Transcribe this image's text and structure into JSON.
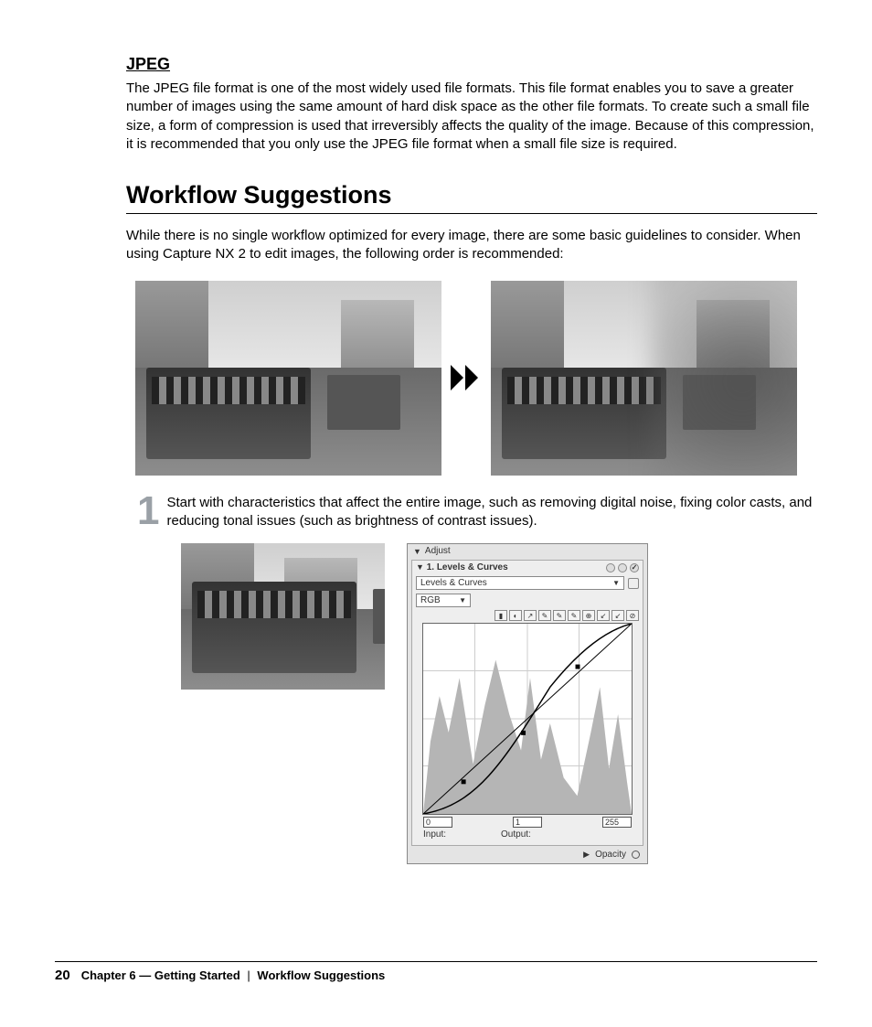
{
  "jpeg": {
    "heading": "JPEG",
    "body": "The JPEG file format is one of the most widely used file formats. This file format enables you to save a greater number of images using the same amount of hard disk space as the other file formats. To create such a small file size, a form of compression is used that irreversibly affects the quality of the image. Because of this compression, it is recommended that you only use the JPEG file format when a small file size is required."
  },
  "workflow": {
    "heading": "Workflow Suggestions",
    "intro": "While there is no single workflow optimized for every image, there are some basic guidelines to consider. When using Capture NX 2 to edit images, the following order is recommended:",
    "step1": {
      "num": "1",
      "text": "Start with characteristics that affect the entire image, such as removing digital noise, fixing color casts, and reducing tonal issues (such as brightness of contrast issues)."
    }
  },
  "panel": {
    "adjust_label": "Adjust",
    "section_title": "1. Levels & Curves",
    "dropdown1": "Levels & Curves",
    "dropdown2": "RGB",
    "input_label": "Input:",
    "output_label": "Output:",
    "val_left": "0",
    "val_mid": "1",
    "val_right": "255",
    "opacity_label": "Opacity"
  },
  "footer": {
    "page": "20",
    "chapter": "Chapter 6 — Getting Started",
    "section": "Workflow Suggestions"
  }
}
